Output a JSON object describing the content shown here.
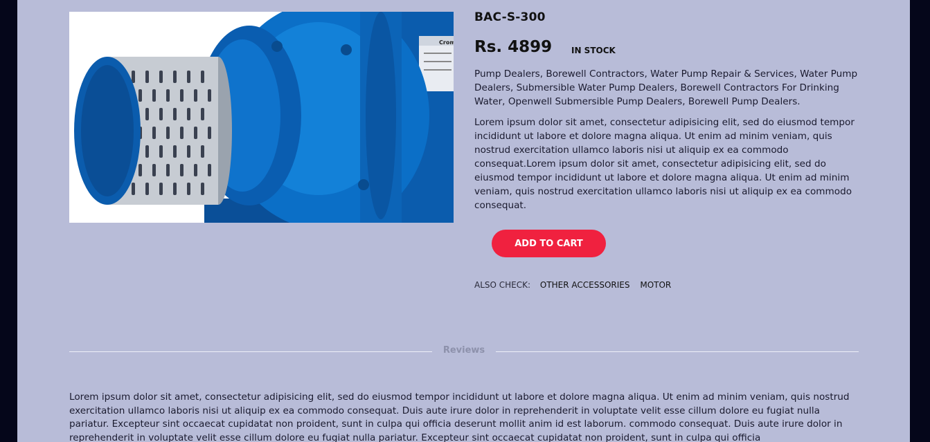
{
  "product": {
    "title": "BAC-S-300",
    "price": "Rs. 4899",
    "stock": "IN STOCK",
    "image": {
      "subject": "pump-image",
      "brand_plate": "Crom"
    },
    "tags_description": "Pump Dealers, Borewell Contractors, Water Pump Repair & Services, Water Pump Dealers, Submersible Water Pump Dealers, Borewell Contractors For Drinking Water, Openwell Submersible Pump Dealers, Borewell Pump Dealers.",
    "description": "Lorem ipsum dolor sit amet, consectetur adipisicing elit, sed do eiusmod tempor incididunt ut labore et dolore magna aliqua. Ut enim ad minim veniam, quis nostrud exercitation ullamco laboris nisi ut aliquip ex ea commodo consequat.Lorem ipsum dolor sit amet, consectetur adipisicing elit, sed do eiusmod tempor incididunt ut labore et dolore magna aliqua. Ut enim ad minim veniam, quis nostrud exercitation ullamco laboris nisi ut aliquip ex ea commodo consequat.",
    "add_to_cart_label": "ADD TO CART",
    "also_check": {
      "label": "ALSO CHECK:",
      "links": [
        "OTHER ACCESSORIES",
        "MOTOR"
      ]
    }
  },
  "reviews": {
    "heading": "Reviews",
    "text": "Lorem ipsum dolor sit amet, consectetur adipisicing elit, sed do eiusmod tempor incididunt ut labore et dolore magna aliqua. Ut enim ad minim veniam, quis nostrud exercitation ullamco laboris nisi ut aliquip ex ea commodo consequat. Duis aute irure dolor in reprehenderit in voluptate velit esse cillum dolore eu fugiat nulla pariatur. Excepteur sint occaecat cupidatat non proident, sunt in culpa qui officia deserunt mollit anim id est laborum. commodo consequat. Duis aute irure dolor in reprehenderit in voluptate velit esse cillum dolore eu fugiat nulla pariatur. Excepteur sint occaecat cupidatat non proident, sunt in culpa qui officia"
  },
  "colors": {
    "page_background": "#b8bcd8",
    "outer_background": "#05061a",
    "accent_button": "#f0213f",
    "pump_blue": "#0a6ec4"
  }
}
